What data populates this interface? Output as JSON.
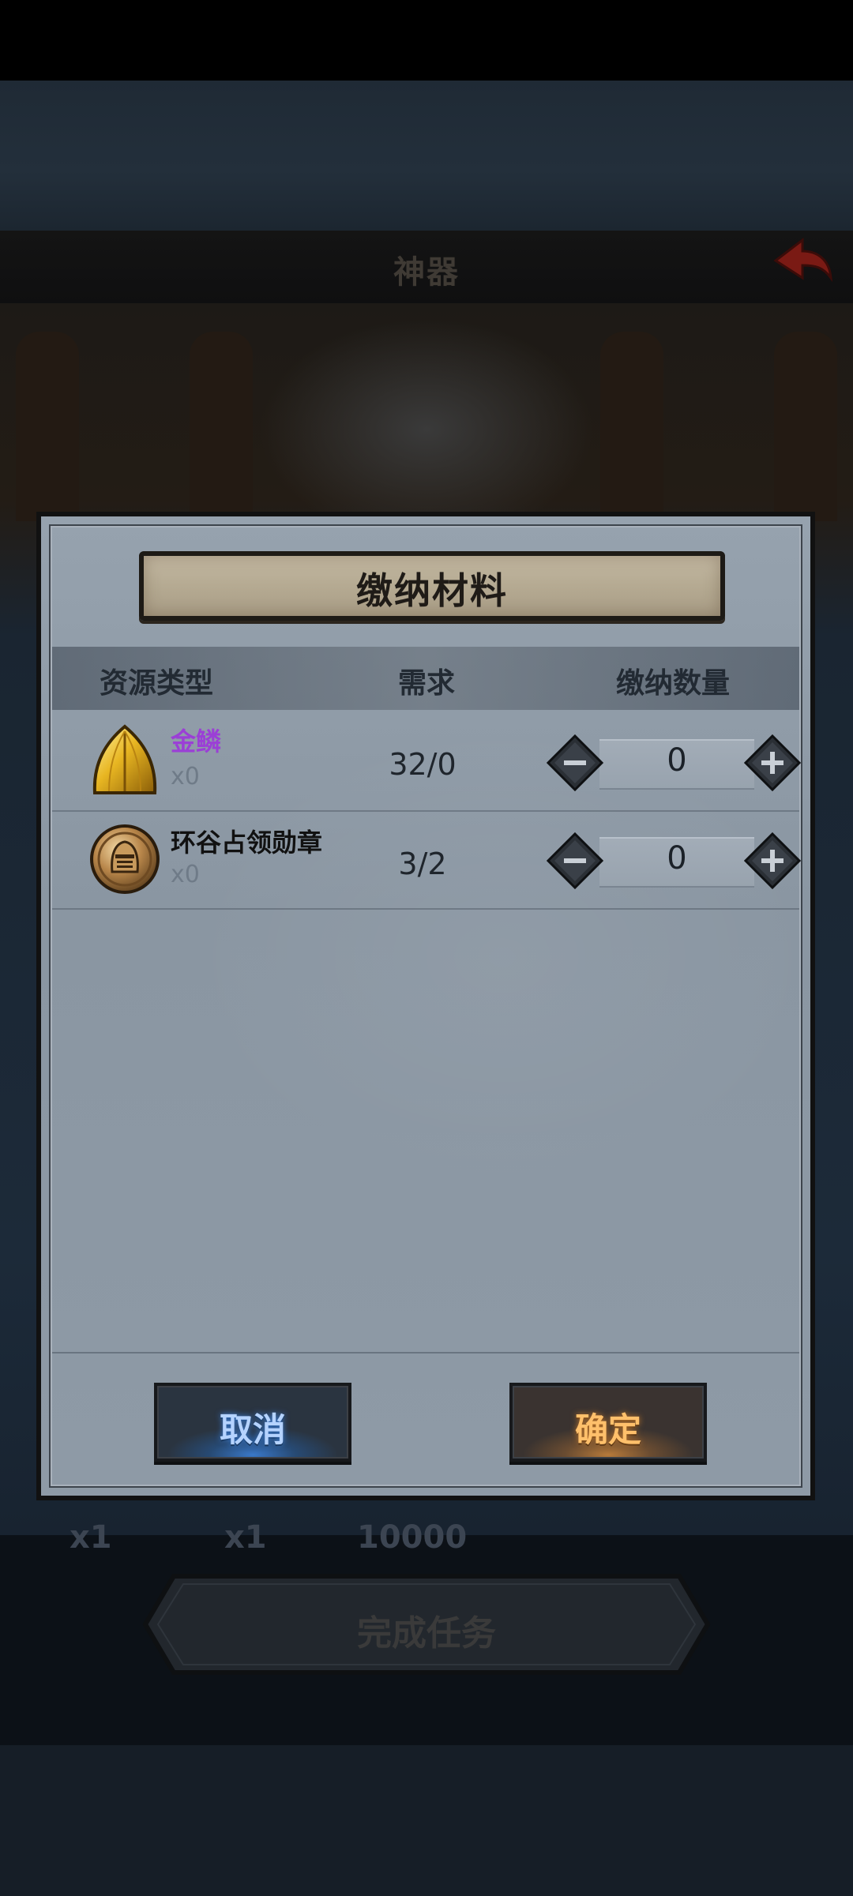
{
  "background": {
    "header_title": "神器",
    "reward_counts": [
      "x1",
      "x1",
      "10000"
    ],
    "complete_task_label": "完成任务"
  },
  "modal": {
    "title": "缴纳材料",
    "columns": {
      "resource_type": "资源类型",
      "requirement": "需求",
      "submit_amount": "缴纳数量"
    },
    "items": [
      {
        "name": "金鳞",
        "owned": "x0",
        "requirement": "32/0",
        "amount": "0",
        "name_color": "#9b3fd6",
        "icon": "golden-scale-icon"
      },
      {
        "name": "环谷占领勋章",
        "owned": "x0",
        "requirement": "3/2",
        "amount": "0",
        "name_color": "#111111",
        "icon": "knight-medal-icon"
      }
    ],
    "cancel_label": "取消",
    "confirm_label": "确定"
  }
}
